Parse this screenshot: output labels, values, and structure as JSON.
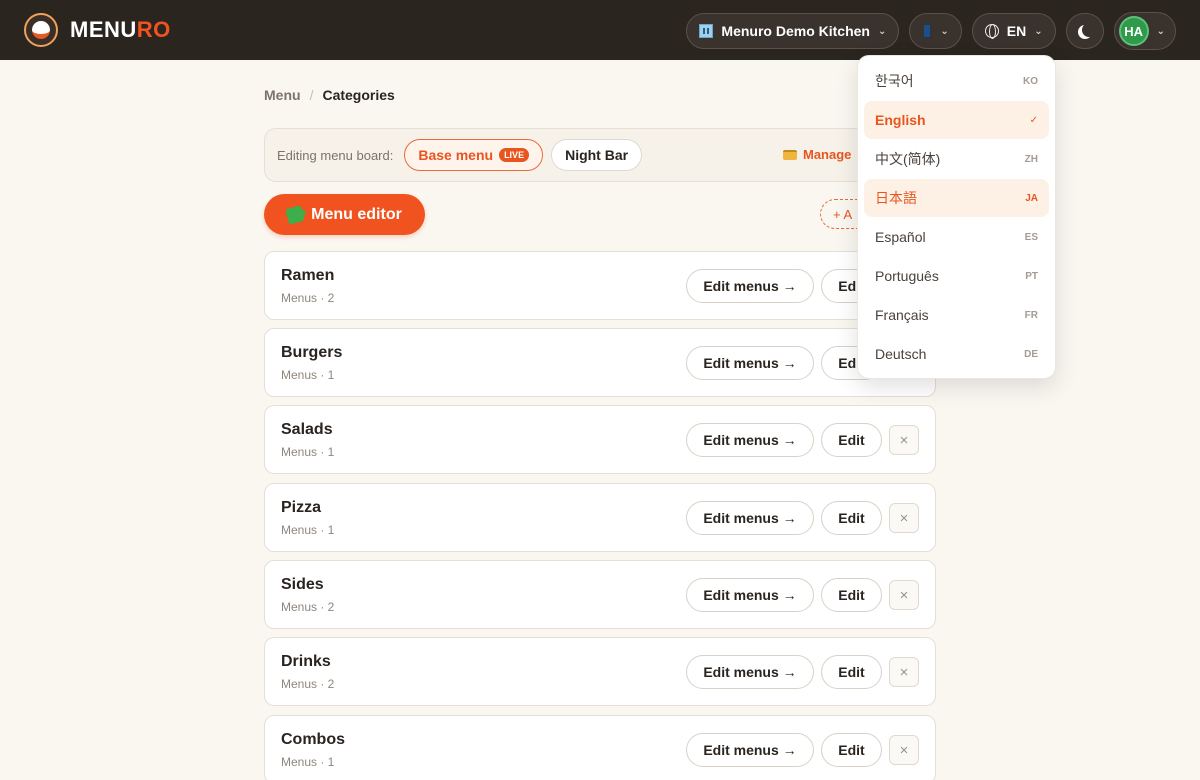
{
  "brand": {
    "name_main": "MENU",
    "name_accent": "RO"
  },
  "header": {
    "kitchen_label": "Menuro Demo Kitchen",
    "lang_label": "EN",
    "avatar_initials": "HA"
  },
  "breadcrumb": {
    "root": "Menu",
    "current": "Categories"
  },
  "board": {
    "label": "Editing menu board:",
    "boards": [
      {
        "label": "Base menu",
        "badge": "LIVE",
        "active": true
      },
      {
        "label": "Night Bar",
        "active": false
      }
    ],
    "manage_label": "Manage"
  },
  "actions": {
    "menu_editor": "Menu editor",
    "add_label": "+ A"
  },
  "categories": [
    {
      "name": "Ramen",
      "meta": "Menus · 2"
    },
    {
      "name": "Burgers",
      "meta": "Menus · 1"
    },
    {
      "name": "Salads",
      "meta": "Menus · 1"
    },
    {
      "name": "Pizza",
      "meta": "Menus · 1"
    },
    {
      "name": "Sides",
      "meta": "Menus · 2"
    },
    {
      "name": "Drinks",
      "meta": "Menus · 2"
    },
    {
      "name": "Combos",
      "meta": "Menus · 1"
    }
  ],
  "row_buttons": {
    "edit_menus": "Edit menus →",
    "edit": "Edit",
    "delete": "×"
  },
  "languages": [
    {
      "label": "한국어",
      "code": "KO"
    },
    {
      "label": "English",
      "code": "✓",
      "selected": true
    },
    {
      "label": "中文(简体)",
      "code": "ZH"
    },
    {
      "label": "日本語",
      "code": "JA",
      "hover": true
    },
    {
      "label": "Español",
      "code": "ES"
    },
    {
      "label": "Português",
      "code": "PT"
    },
    {
      "label": "Français",
      "code": "FR"
    },
    {
      "label": "Deutsch",
      "code": "DE"
    }
  ],
  "colors": {
    "accent": "#f0531f",
    "topbar": "#2b2520",
    "background": "#faf7f1"
  }
}
